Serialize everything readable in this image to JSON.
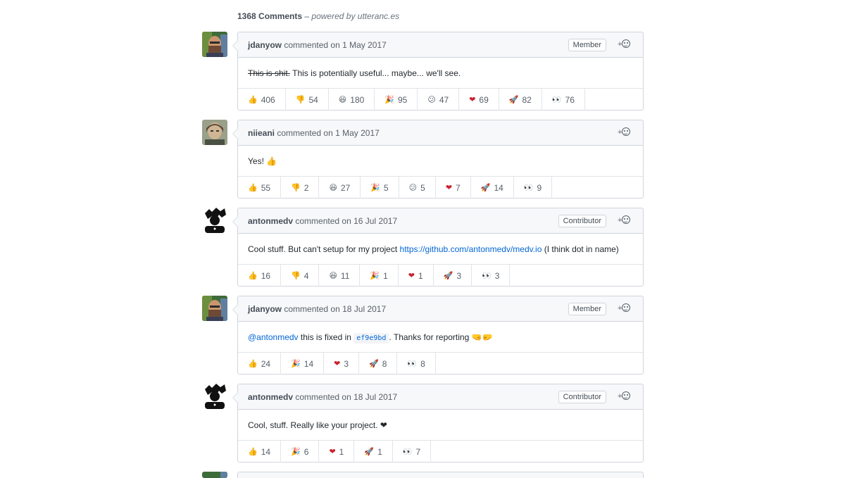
{
  "header": {
    "count": "1368 Comments",
    "separator": "–",
    "powered": "powered by utteranc.es"
  },
  "comments": [
    {
      "author": "jdanyow",
      "verb": "commented",
      "date": "on 1 May 2017",
      "role": "Member",
      "body_strike": "This is shit.",
      "body_text": " This is potentially useful... maybe... we'll see.",
      "reactions": [
        {
          "icon": "👍",
          "count": "406"
        },
        {
          "icon": "👎",
          "count": "54"
        },
        {
          "icon": "😆",
          "count": "180"
        },
        {
          "icon": "🎉",
          "count": "95"
        },
        {
          "icon": "😕",
          "count": "47"
        },
        {
          "icon": "❤",
          "count": "69"
        },
        {
          "icon": "🚀",
          "count": "82"
        },
        {
          "icon": "👀",
          "count": "76"
        }
      ]
    },
    {
      "author": "niieani",
      "verb": "commented",
      "date": "on 1 May 2017",
      "body_text": "Yes! 👍",
      "reactions": [
        {
          "icon": "👍",
          "count": "55"
        },
        {
          "icon": "👎",
          "count": "2"
        },
        {
          "icon": "😆",
          "count": "27"
        },
        {
          "icon": "🎉",
          "count": "5"
        },
        {
          "icon": "😕",
          "count": "5"
        },
        {
          "icon": "❤",
          "count": "7"
        },
        {
          "icon": "🚀",
          "count": "14"
        },
        {
          "icon": "👀",
          "count": "9"
        }
      ]
    },
    {
      "author": "antonmedv",
      "verb": "commented",
      "date": "on 16 Jul 2017",
      "role": "Contributor",
      "body_text": "Cool stuff. But can't setup for my project ",
      "body_link": "https://github.com/antonmedv/medv.io",
      "body_after": " (I think dot in name)",
      "reactions": [
        {
          "icon": "👍",
          "count": "16"
        },
        {
          "icon": "👎",
          "count": "4"
        },
        {
          "icon": "😆",
          "count": "11"
        },
        {
          "icon": "🎉",
          "count": "1"
        },
        {
          "icon": "❤",
          "count": "1"
        },
        {
          "icon": "🚀",
          "count": "3"
        },
        {
          "icon": "👀",
          "count": "3"
        }
      ]
    },
    {
      "author": "jdanyow",
      "verb": "commented",
      "date": "on 18 Jul 2017",
      "role": "Member",
      "body_mention": "@antonmedv",
      "body_text": " this is fixed in ",
      "body_code": "ef9e9bd",
      "body_after": ". Thanks for reporting 🤜🤛",
      "reactions": [
        {
          "icon": "👍",
          "count": "24"
        },
        {
          "icon": "🎉",
          "count": "14"
        },
        {
          "icon": "❤",
          "count": "3"
        },
        {
          "icon": "🚀",
          "count": "8"
        },
        {
          "icon": "👀",
          "count": "8"
        }
      ]
    },
    {
      "author": "antonmedv",
      "verb": "commented",
      "date": "on 18 Jul 2017",
      "role": "Contributor",
      "body_text": "Cool, stuff. Really like your project. ❤",
      "reactions": [
        {
          "icon": "👍",
          "count": "14"
        },
        {
          "icon": "🎉",
          "count": "6"
        },
        {
          "icon": "❤",
          "count": "1"
        },
        {
          "icon": "🚀",
          "count": "1"
        },
        {
          "icon": "👀",
          "count": "7"
        }
      ]
    }
  ],
  "react_button": {
    "plus": "+"
  },
  "colors": {
    "link": "#0366d6",
    "border": "#d1d5da",
    "header_bg": "#f6f8fa",
    "heart": "#cb2431"
  }
}
